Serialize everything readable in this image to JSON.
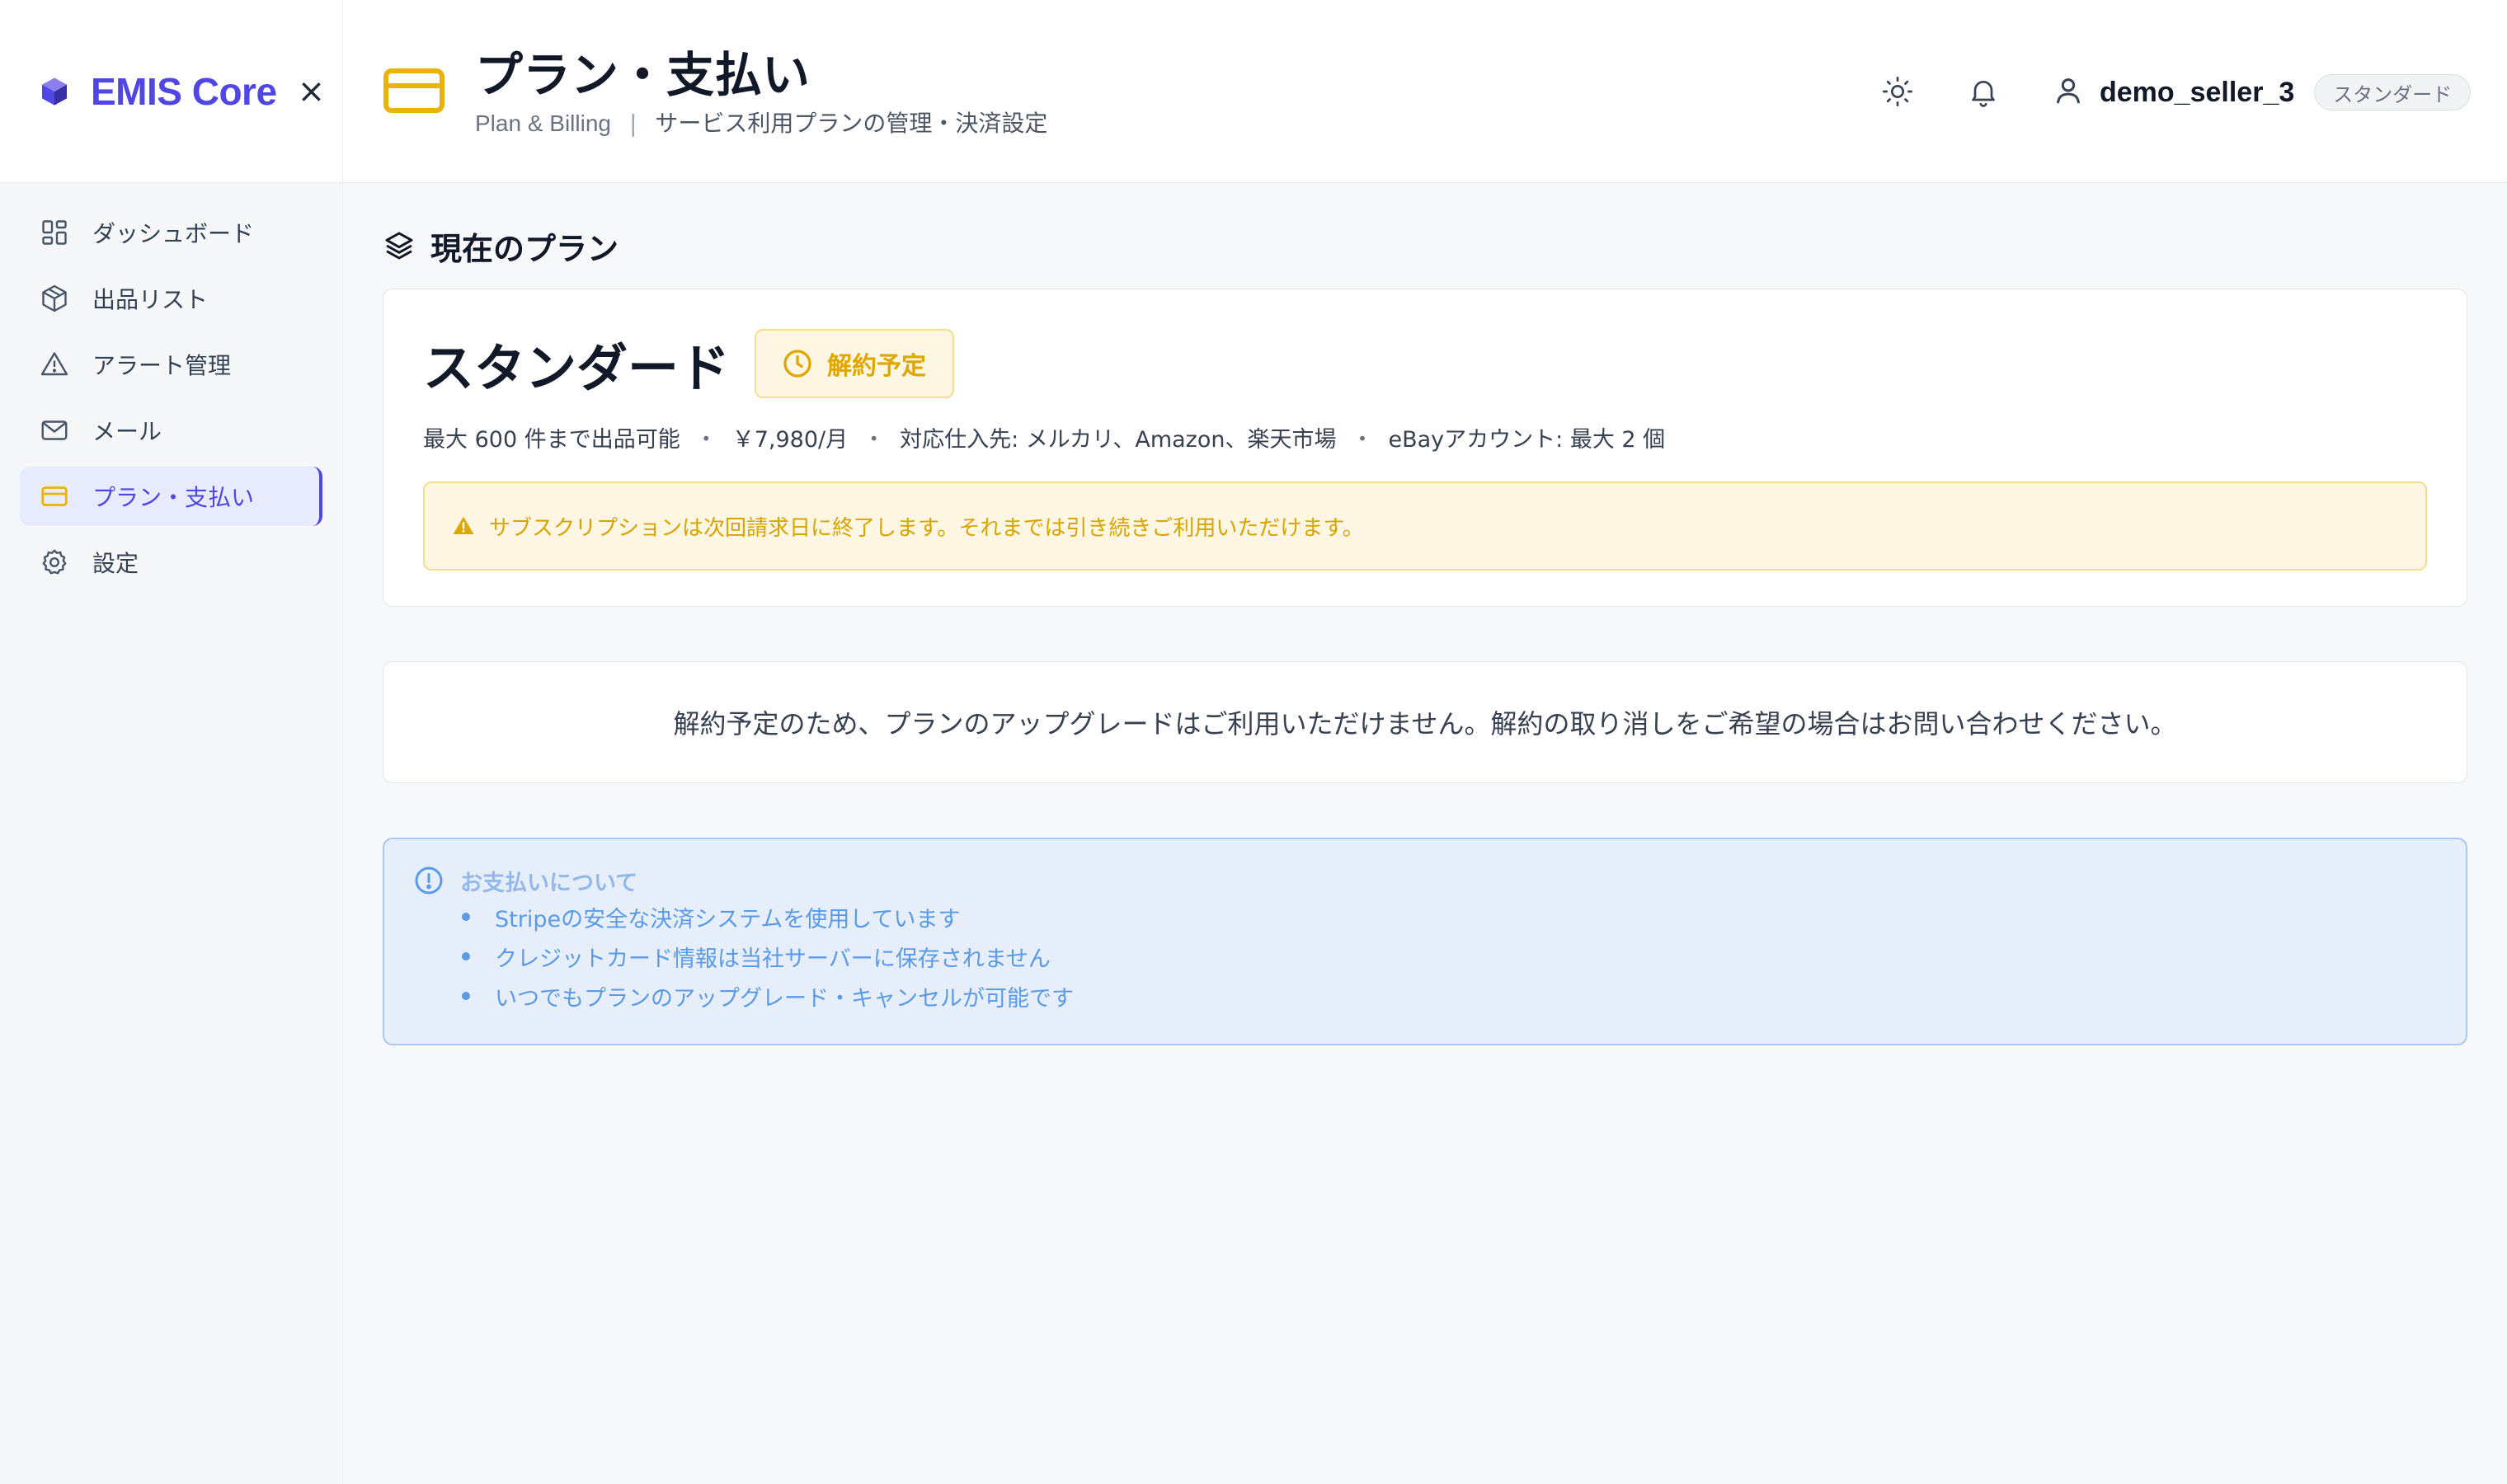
{
  "sidebar": {
    "brand": "EMIS Core",
    "close_label": "×",
    "items": [
      {
        "label": "ダッシュボード",
        "icon": "dashboard-grid-icon"
      },
      {
        "label": "出品リスト",
        "icon": "package-icon"
      },
      {
        "label": "アラート管理",
        "icon": "alert-triangle-icon"
      },
      {
        "label": "メール",
        "icon": "mail-icon"
      },
      {
        "label": "プラン・支払い",
        "icon": "credit-card-icon",
        "active": true
      },
      {
        "label": "設定",
        "icon": "gear-icon"
      }
    ]
  },
  "header": {
    "title": "プラン・支払い",
    "subtitle_en": "Plan & Billing",
    "subtitle_sep": "|",
    "subtitle_jp": "サービス利用プランの管理・決済設定",
    "user_name": "demo_seller_3",
    "user_plan_badge": "スタンダード"
  },
  "main": {
    "section_title": "現在のプラン",
    "plan": {
      "name": "スタンダード",
      "status": "解約予定",
      "details": [
        "最大 600 件まで出品可能",
        "￥7,980/月",
        "対応仕入先: メルカリ、Amazon、楽天市場",
        "eBayアカウント: 最大 2 個"
      ],
      "detail_sep": "・",
      "alert": "サブスクリプションは次回請求日に終了します。それまでは引き続きご利用いただけます。"
    },
    "notice": "解約予定のため、プランのアップグレードはご利用いただけません。解約の取り消しをご希望の場合はお問い合わせください。",
    "info": {
      "title": "お支払いについて",
      "items": [
        "Stripeの安全な決済システムを使用しています",
        "クレジットカード情報は当社サーバーに保存されません",
        "いつでもプランのアップグレード・キャンセルが可能です"
      ]
    }
  },
  "colors": {
    "brand": "#4f46e5",
    "warning": "#e0a700",
    "info": "#5b9ae6"
  }
}
